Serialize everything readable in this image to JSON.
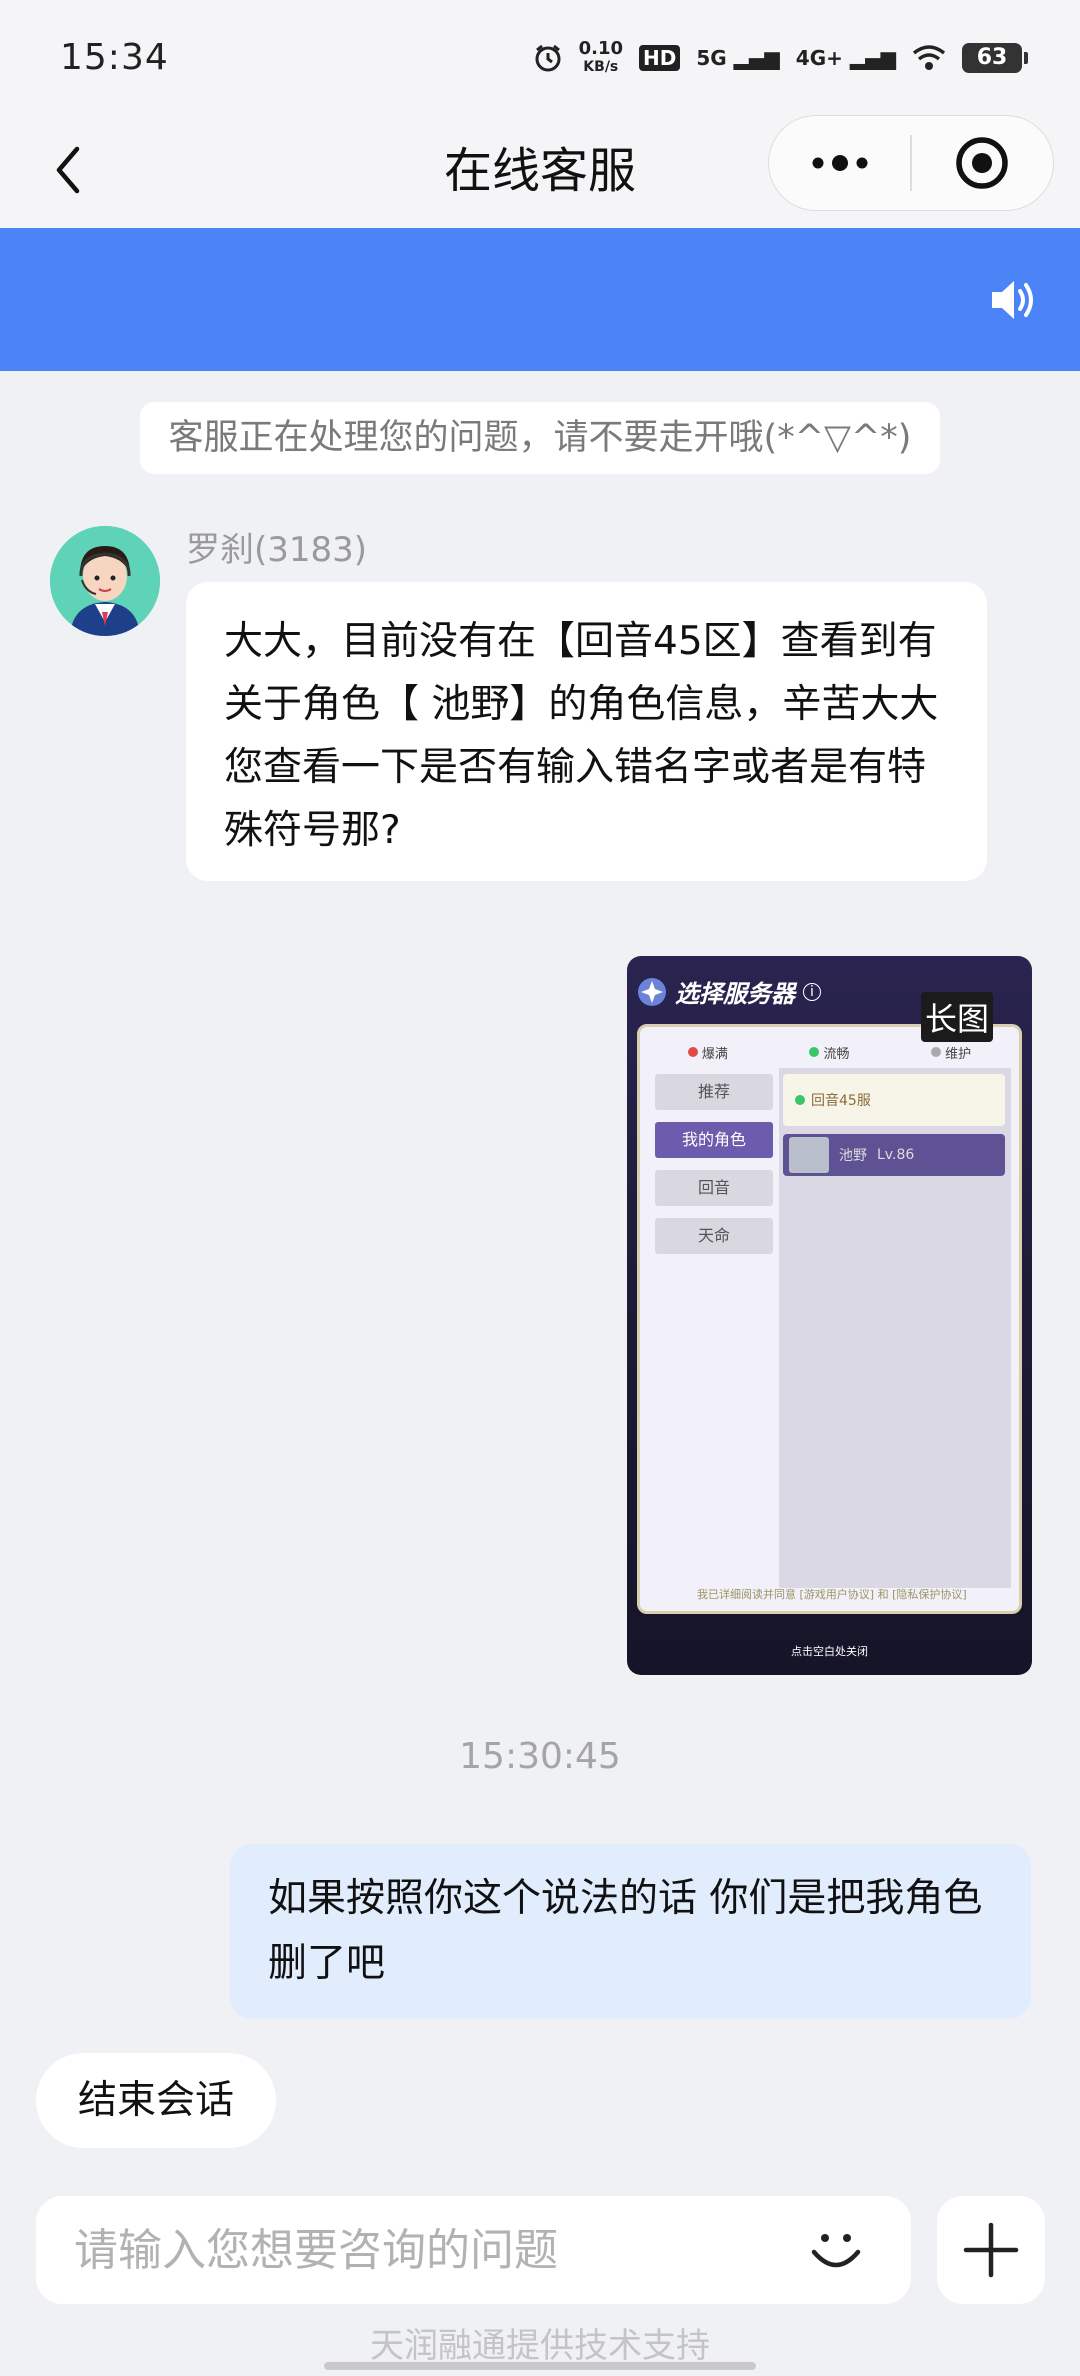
{
  "status_bar": {
    "time": "15:34",
    "net_speed_value": "0.10",
    "net_speed_unit": "KB/s",
    "hd_label": "HD",
    "signal_5g": "5G",
    "signal_4g": "4G+",
    "battery": "63"
  },
  "nav": {
    "title": "在线客服",
    "back_icon": "chevron-left-icon",
    "more_icon": "more-dots-icon",
    "close_icon": "target-circle-icon"
  },
  "banner": {
    "color": "#4b84f7",
    "icon": "speaker-icon"
  },
  "notice": "客服正在处理您的问题，请不要走开哦(*^▽^*)",
  "agent": {
    "name": "罗刹(3183)",
    "message": "大大，目前没有在【回音45区】查看到有关于角色【 池野】的角色信息，辛苦大大您查看一下是否有输入错名字或者是有特殊符号那?"
  },
  "image_message": {
    "badge": "长图",
    "game": {
      "title": "选择服务器",
      "legend": [
        "爆满",
        "流畅",
        "维护"
      ],
      "tabs": [
        "推荐",
        "我的角色",
        "回音",
        "天命"
      ],
      "server": "回音45服",
      "role_name": "池野",
      "role_level": "Lv.86",
      "agreement": "我已详细阅读并同意 [游戏用户协议] 和 [隐私保护协议]",
      "footer": "点击空白处关闭"
    }
  },
  "timestamp": "15:30:45",
  "user": {
    "message": "如果按照你这个说法的话 你们是把我角色删了吧"
  },
  "actions": {
    "end_session": "结束会话"
  },
  "composer": {
    "placeholder": "请输入您想要咨询的问题",
    "emoji_icon": "smile-icon",
    "plus_icon": "plus-icon"
  },
  "footer": {
    "support": "天润融通提供技术支持"
  },
  "colors": {
    "accent": "#4b84f7",
    "user_bubble": "#e1ecfd",
    "background": "#eff1f5"
  }
}
